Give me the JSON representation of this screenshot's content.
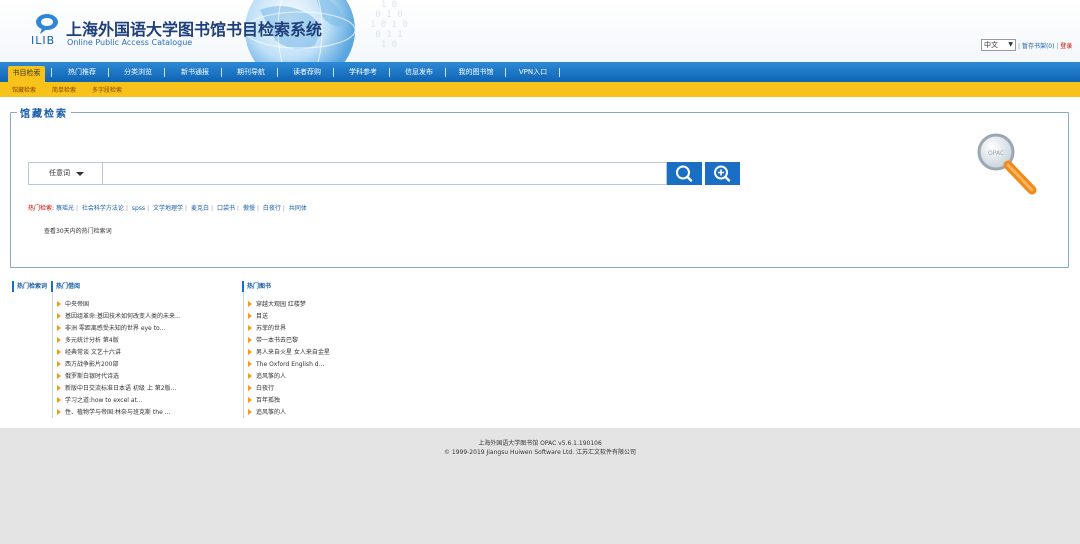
{
  "header": {
    "logo_text": "ILIB",
    "title": "上海外国语大学图书馆书目检索系统",
    "subtitle": "Online Public Access Catalogue",
    "language": "中文",
    "link_bookshelf": "暂存书架(0)",
    "link_login": "登录"
  },
  "nav": {
    "items": [
      "书目检索",
      "热门推荐",
      "分类浏览",
      "新书通报",
      "期刊导航",
      "读者荐购",
      "学科参考",
      "信息发布",
      "我的图书馆",
      "VPN入口"
    ]
  },
  "subnav": {
    "items": [
      "馆藏检索",
      "简单检索",
      "多字段检索"
    ]
  },
  "search": {
    "panel_title": "馆藏检索",
    "field_select": "任意词",
    "input_value": "",
    "search_icon": "search-icon",
    "advanced_icon": "zoom-in-icon",
    "hot_label": "热门检索:",
    "hot_keywords": [
      "蔡瑶光",
      "社会科学方法论",
      "spss",
      "文学地理学",
      "麦克白",
      "口袋书",
      "傲慢",
      "白夜行",
      "共同体"
    ],
    "hot_note": "查看30天内的热门检索词"
  },
  "lists": {
    "tab_hot_search": "热门检索词",
    "tab_hot_borrow": "热门借阅",
    "hot_borrow": [
      "中央帝国",
      "基因组革命:基因技术如何改变人类的未来...",
      "非洲 零距离感受未知的世界 eye to...",
      "多元统计分析 第4版",
      "经典常谈 文艺十六讲",
      "西方战争影片200部",
      "俄罗斯白银时代诗选",
      "新版中日交流标准日本语 初级 上 第2版...",
      "学习之道:how to excel at...",
      "性、植物学与帝国:林奈与班克斯 the ..."
    ],
    "tab_hot_books": "热门图书",
    "hot_books": [
      "穿越大观园 红楼梦",
      "目送",
      "苏菲的世界",
      "带一本书去巴黎",
      "男人来自火星 女人来自金星",
      "The Oxford English d...",
      "追风筝的人",
      "白夜行",
      "百年孤独",
      "追风筝的人"
    ]
  },
  "footer": {
    "line1": "上海外国语大学图书馆   OPAC v5.6.1.190106",
    "line2": "© 1999-2019 Jiangsu Huiwen Software Ltd. 江苏汇文软件有限公司"
  },
  "colors": {
    "nav_blue": "#1a6ec4",
    "nav_active": "#f7c21a",
    "link_blue": "#1a5fa8",
    "hot_red": "#cc0000"
  }
}
